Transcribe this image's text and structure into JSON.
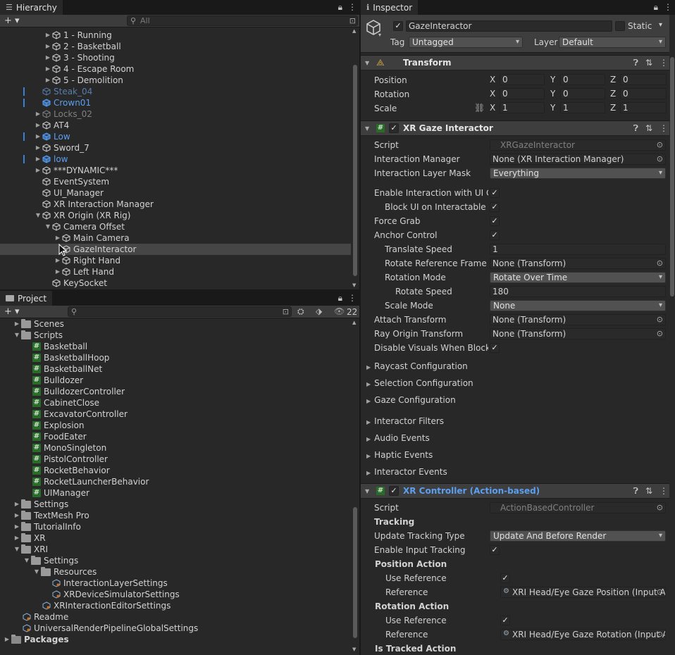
{
  "hierarchy": {
    "tab": "Hierarchy",
    "search_placeholder": "All",
    "items": [
      {
        "label": "1 - Running",
        "arrow": "▶",
        "style": "lbl",
        "indent": 62
      },
      {
        "label": "2 - Basketball",
        "arrow": "▶",
        "style": "lbl",
        "indent": 62
      },
      {
        "label": "3 - Shooting",
        "arrow": "▶",
        "style": "lbl",
        "indent": 62
      },
      {
        "label": "4 - Escape Room",
        "arrow": "▶",
        "style": "lbl",
        "indent": 62
      },
      {
        "label": "5 - Demolition",
        "arrow": "▶",
        "style": "lbl",
        "indent": 62
      },
      {
        "label": "Steak_04",
        "arrow": "",
        "style": "dimblue",
        "indent": 48,
        "mark": true
      },
      {
        "label": "Crown01",
        "arrow": "",
        "style": "blue",
        "indent": 48,
        "mark": true
      },
      {
        "label": "Locks_02",
        "arrow": "▶",
        "style": "dim",
        "indent": 48
      },
      {
        "label": "AT4",
        "arrow": "▶",
        "style": "lbl",
        "indent": 48
      },
      {
        "label": "Low",
        "arrow": "▶",
        "style": "blue",
        "indent": 48,
        "mark": true
      },
      {
        "label": "Sword_7",
        "arrow": "▶",
        "style": "lbl",
        "indent": 48
      },
      {
        "label": "low",
        "arrow": "▶",
        "style": "blue",
        "indent": 48,
        "mark": true
      },
      {
        "label": "***DYNAMIC***",
        "arrow": "▶",
        "style": "lbl",
        "indent": 48
      },
      {
        "label": "EventSystem",
        "arrow": "",
        "style": "lbl",
        "indent": 48
      },
      {
        "label": "UI_Manager",
        "arrow": "",
        "style": "lbl",
        "indent": 48
      },
      {
        "label": "XR Interaction Manager",
        "arrow": "",
        "style": "lbl",
        "indent": 48
      },
      {
        "label": "XR Origin (XR Rig)",
        "arrow": "▼",
        "style": "lbl",
        "indent": 48
      },
      {
        "label": "Camera Offset",
        "arrow": "▼",
        "style": "lbl",
        "indent": 62
      },
      {
        "label": "Main Camera",
        "arrow": "▶",
        "style": "lbl",
        "indent": 76
      },
      {
        "label": "GazeInteractor",
        "arrow": "",
        "style": "lbl",
        "indent": 76,
        "selected": true
      },
      {
        "label": "Right Hand",
        "arrow": "▶",
        "style": "lbl",
        "indent": 76
      },
      {
        "label": "Left Hand",
        "arrow": "▶",
        "style": "lbl",
        "indent": 76
      },
      {
        "label": "KeySocket",
        "arrow": "",
        "style": "lbl",
        "indent": 62
      }
    ]
  },
  "project": {
    "tab": "Project",
    "hidden_count": "22",
    "items": [
      {
        "label": "Scenes",
        "type": "folder",
        "arrow": "▶",
        "indent": 18
      },
      {
        "label": "Scripts",
        "type": "folder",
        "arrow": "▼",
        "indent": 18
      },
      {
        "label": "Basketball",
        "type": "script",
        "indent": 46
      },
      {
        "label": "BasketballHoop",
        "type": "script",
        "indent": 46
      },
      {
        "label": "BasketballNet",
        "type": "script",
        "indent": 46
      },
      {
        "label": "Bulldozer",
        "type": "script",
        "indent": 46
      },
      {
        "label": "BulldozerController",
        "type": "script",
        "indent": 46
      },
      {
        "label": "CabinetClose",
        "type": "script",
        "indent": 46
      },
      {
        "label": "ExcavatorController",
        "type": "script",
        "indent": 46
      },
      {
        "label": "Explosion",
        "type": "script",
        "indent": 46
      },
      {
        "label": "FoodEater",
        "type": "script",
        "indent": 46
      },
      {
        "label": "MonoSingleton",
        "type": "script",
        "indent": 46
      },
      {
        "label": "PistolController",
        "type": "script",
        "indent": 46
      },
      {
        "label": "RocketBehavior",
        "type": "script",
        "indent": 46
      },
      {
        "label": "RocketLauncherBehavior",
        "type": "script",
        "indent": 46
      },
      {
        "label": "UIManager",
        "type": "script",
        "indent": 46
      },
      {
        "label": "Settings",
        "type": "folder",
        "arrow": "▶",
        "indent": 18
      },
      {
        "label": "TextMesh Pro",
        "type": "folder",
        "arrow": "▶",
        "indent": 18
      },
      {
        "label": "TutorialInfo",
        "type": "folder",
        "arrow": "▶",
        "indent": 18
      },
      {
        "label": "XR",
        "type": "folder",
        "arrow": "▶",
        "indent": 18
      },
      {
        "label": "XRI",
        "type": "folder",
        "arrow": "▼",
        "indent": 18
      },
      {
        "label": "Settings",
        "type": "folder",
        "arrow": "▼",
        "indent": 32
      },
      {
        "label": "Resources",
        "type": "folder",
        "arrow": "▼",
        "indent": 46
      },
      {
        "label": "InteractionLayerSettings",
        "type": "so",
        "indent": 74
      },
      {
        "label": "XRDeviceSimulatorSettings",
        "type": "so",
        "indent": 74
      },
      {
        "label": "XRInteractionEditorSettings",
        "type": "so",
        "indent": 60
      },
      {
        "label": "Readme",
        "type": "so",
        "indent": 32
      },
      {
        "label": "UniversalRenderPipelineGlobalSettings",
        "type": "so",
        "indent": 32
      },
      {
        "label": "Packages",
        "type": "folder",
        "arrow": "▶",
        "indent": 4,
        "bold": true
      }
    ]
  },
  "inspector": {
    "tab": "Inspector",
    "object_name": "GazeInteractor",
    "static_label": "Static",
    "tag_label": "Tag",
    "tag_value": "Untagged",
    "layer_label": "Layer",
    "layer_value": "Default",
    "transform": {
      "title": "Transform",
      "position_label": "Position",
      "rotation_label": "Rotation",
      "scale_label": "Scale",
      "x": "X",
      "y": "Y",
      "z": "Z",
      "position": [
        "0",
        "0",
        "0"
      ],
      "rotation": [
        "0",
        "0",
        "0"
      ],
      "scale": [
        "1",
        "1",
        "1"
      ]
    },
    "gaze": {
      "title": "XR Gaze Interactor",
      "script_label": "Script",
      "script_value": "XRGazeInteractor",
      "interaction_manager_label": "Interaction Manager",
      "interaction_manager_value": "None (XR Interaction Manager)",
      "layer_mask_label": "Interaction Layer Mask",
      "layer_mask_value": "Everything",
      "enable_ui_label": "Enable Interaction with UI Ga",
      "block_ui_label": "Block UI on Interactable Se",
      "force_grab_label": "Force Grab",
      "anchor_control_label": "Anchor Control",
      "translate_speed_label": "Translate Speed",
      "translate_speed_value": "1",
      "rotate_ref_label": "Rotate Reference Frame",
      "rotate_ref_value": "None (Transform)",
      "rotation_mode_label": "Rotation Mode",
      "rotation_mode_value": "Rotate Over Time",
      "rotate_speed_label": "Rotate Speed",
      "rotate_speed_value": "180",
      "scale_mode_label": "Scale Mode",
      "scale_mode_value": "None",
      "attach_transform_label": "Attach Transform",
      "attach_transform_value": "None (Transform)",
      "ray_origin_label": "Ray Origin Transform",
      "ray_origin_value": "None (Transform)",
      "disable_visuals_label": "Disable Visuals When Blocke",
      "check": "✓",
      "foldouts": [
        "Raycast Configuration",
        "Selection Configuration",
        "Gaze Configuration",
        "Interactor Filters",
        "Audio Events",
        "Haptic Events",
        "Interactor Events"
      ]
    },
    "controller": {
      "title": "XR Controller (Action-based)",
      "script_label": "Script",
      "script_value": "ActionBasedController",
      "tracking_label": "Tracking",
      "update_tracking_label": "Update Tracking Type",
      "update_tracking_value": "Update And Before Render",
      "enable_input_label": "Enable Input Tracking",
      "position_action_label": "Position Action",
      "use_reference_label": "Use Reference",
      "reference_label": "Reference",
      "position_ref_value": "XRI Head/Eye Gaze Position (Input A",
      "rotation_action_label": "Rotation Action",
      "rotation_ref_value": "XRI Head/Eye Gaze Rotation (Input A",
      "is_tracked_label": "Is Tracked Action"
    }
  }
}
